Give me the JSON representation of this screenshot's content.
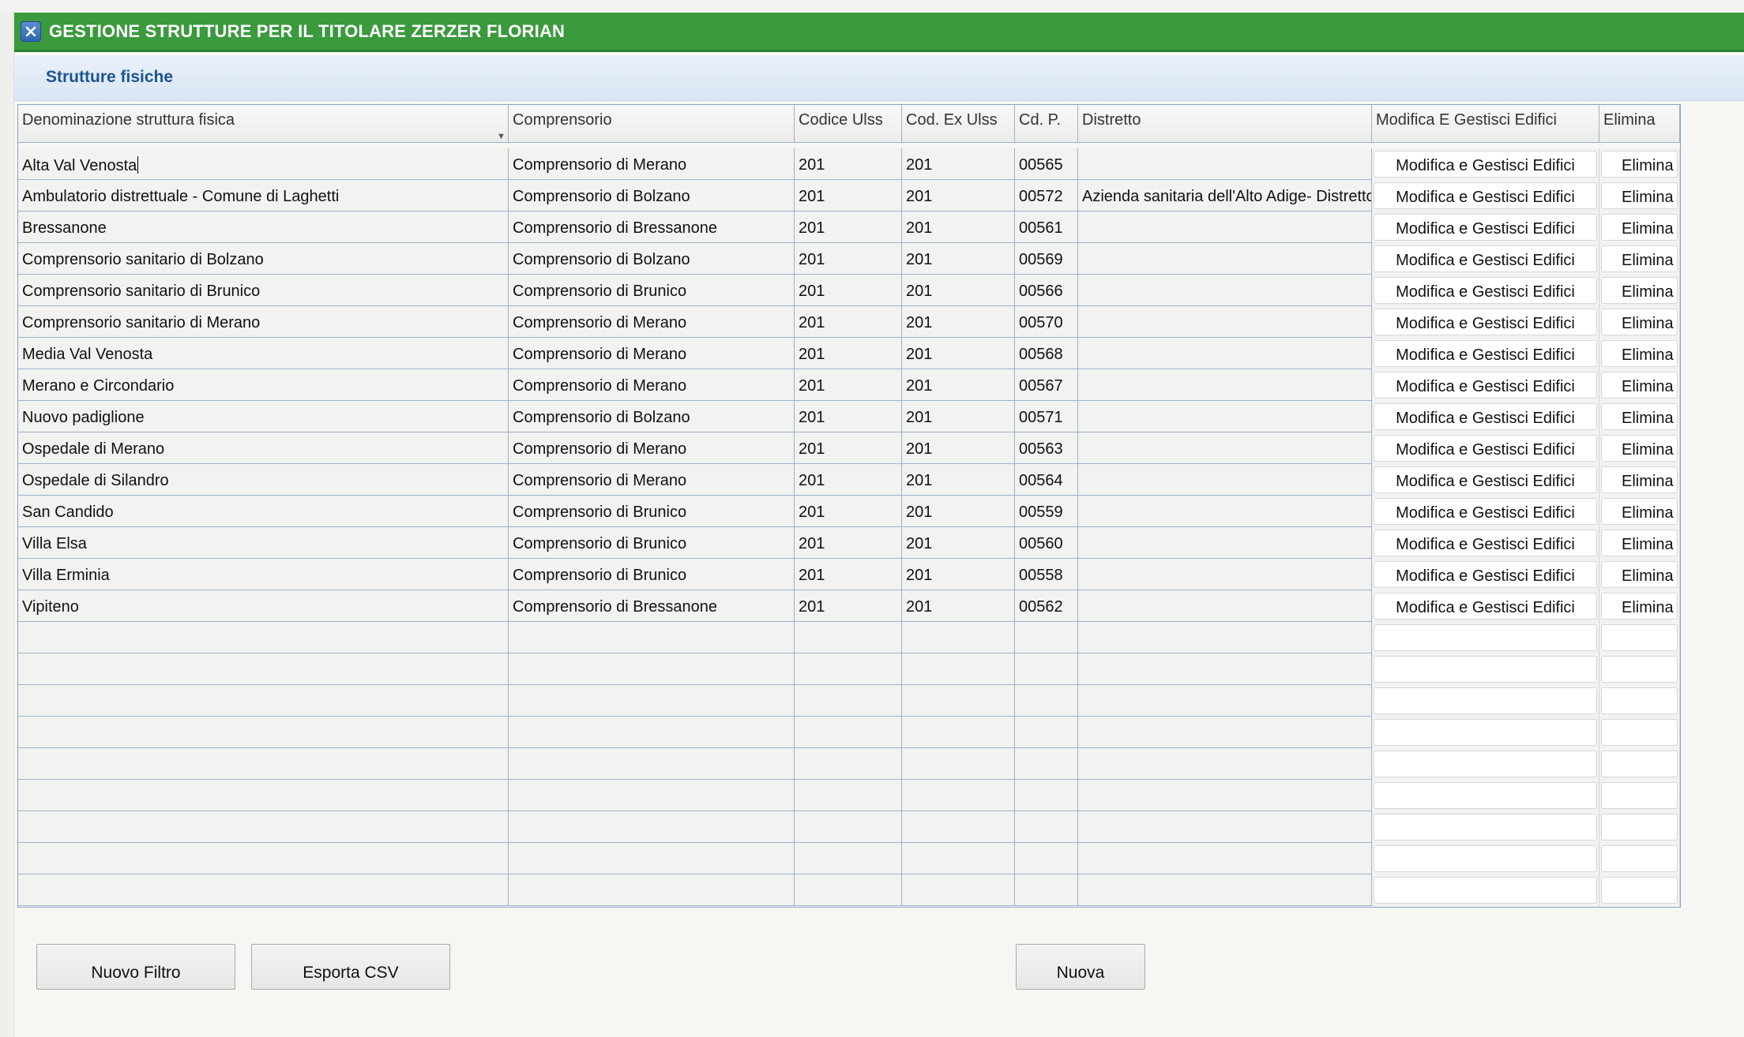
{
  "window": {
    "title": "GESTIONE STRUTTURE PER IL TITOLARE ZERZER FLORIAN",
    "section_title": "Strutture fisiche"
  },
  "table": {
    "headers": [
      "Denominazione struttura fisica",
      "Comprensorio",
      "Codice Ulss",
      "Cod. Ex Ulss",
      "Cd. P.",
      "Distretto",
      "Modifica E Gestisci Edifici",
      "Elimina"
    ],
    "edit_button_label": "Modifica e Gestisci Edifici",
    "delete_button_label": "Elimina",
    "rows": [
      {
        "name": "Alta Val Venosta",
        "comprensorio": "Comprensorio di Merano",
        "codice_ulss": "201",
        "cod_ex_ulss": "201",
        "cd_p": "00565",
        "distretto": ""
      },
      {
        "name": "Ambulatorio distrettuale - Comune di Laghetti",
        "comprensorio": "Comprensorio di Bolzano",
        "codice_ulss": "201",
        "cod_ex_ulss": "201",
        "cd_p": "00572",
        "distretto": "Azienda sanitaria dell'Alto Adige- Distretto"
      },
      {
        "name": "Bressanone",
        "comprensorio": "Comprensorio di Bressanone",
        "codice_ulss": "201",
        "cod_ex_ulss": "201",
        "cd_p": "00561",
        "distretto": ""
      },
      {
        "name": "Comprensorio sanitario di Bolzano",
        "comprensorio": "Comprensorio di Bolzano",
        "codice_ulss": "201",
        "cod_ex_ulss": "201",
        "cd_p": "00569",
        "distretto": ""
      },
      {
        "name": "Comprensorio sanitario di Brunico",
        "comprensorio": "Comprensorio di Brunico",
        "codice_ulss": "201",
        "cod_ex_ulss": "201",
        "cd_p": "00566",
        "distretto": ""
      },
      {
        "name": "Comprensorio sanitario di Merano",
        "comprensorio": "Comprensorio di Merano",
        "codice_ulss": "201",
        "cod_ex_ulss": "201",
        "cd_p": "00570",
        "distretto": ""
      },
      {
        "name": "Media Val Venosta",
        "comprensorio": "Comprensorio di Merano",
        "codice_ulss": "201",
        "cod_ex_ulss": "201",
        "cd_p": "00568",
        "distretto": ""
      },
      {
        "name": "Merano e Circondario",
        "comprensorio": "Comprensorio di Merano",
        "codice_ulss": "201",
        "cod_ex_ulss": "201",
        "cd_p": "00567",
        "distretto": ""
      },
      {
        "name": "Nuovo padiglione",
        "comprensorio": "Comprensorio di Bolzano",
        "codice_ulss": "201",
        "cod_ex_ulss": "201",
        "cd_p": "00571",
        "distretto": ""
      },
      {
        "name": "Ospedale di Merano",
        "comprensorio": "Comprensorio di Merano",
        "codice_ulss": "201",
        "cod_ex_ulss": "201",
        "cd_p": "00563",
        "distretto": ""
      },
      {
        "name": "Ospedale di Silandro",
        "comprensorio": "Comprensorio di Merano",
        "codice_ulss": "201",
        "cod_ex_ulss": "201",
        "cd_p": "00564",
        "distretto": ""
      },
      {
        "name": "San Candido",
        "comprensorio": "Comprensorio di Brunico",
        "codice_ulss": "201",
        "cod_ex_ulss": "201",
        "cd_p": "00559",
        "distretto": ""
      },
      {
        "name": "Villa Elsa",
        "comprensorio": "Comprensorio di Brunico",
        "codice_ulss": "201",
        "cod_ex_ulss": "201",
        "cd_p": "00560",
        "distretto": ""
      },
      {
        "name": "Villa Erminia",
        "comprensorio": "Comprensorio di Brunico",
        "codice_ulss": "201",
        "cod_ex_ulss": "201",
        "cd_p": "00558",
        "distretto": ""
      },
      {
        "name": "Vipiteno",
        "comprensorio": "Comprensorio di Bressanone",
        "codice_ulss": "201",
        "cod_ex_ulss": "201",
        "cd_p": "00562",
        "distretto": ""
      }
    ],
    "empty_rows": 9
  },
  "footer": {
    "new_filter_label": "Nuovo Filtro",
    "export_csv_label": "Esporta CSV",
    "new_label": "Nuova"
  },
  "icons": {
    "close": "close-icon",
    "sort": "sort-arrow-icon"
  },
  "colors": {
    "titlebar": "#3a9a3d",
    "section_title": "#1d5391"
  }
}
